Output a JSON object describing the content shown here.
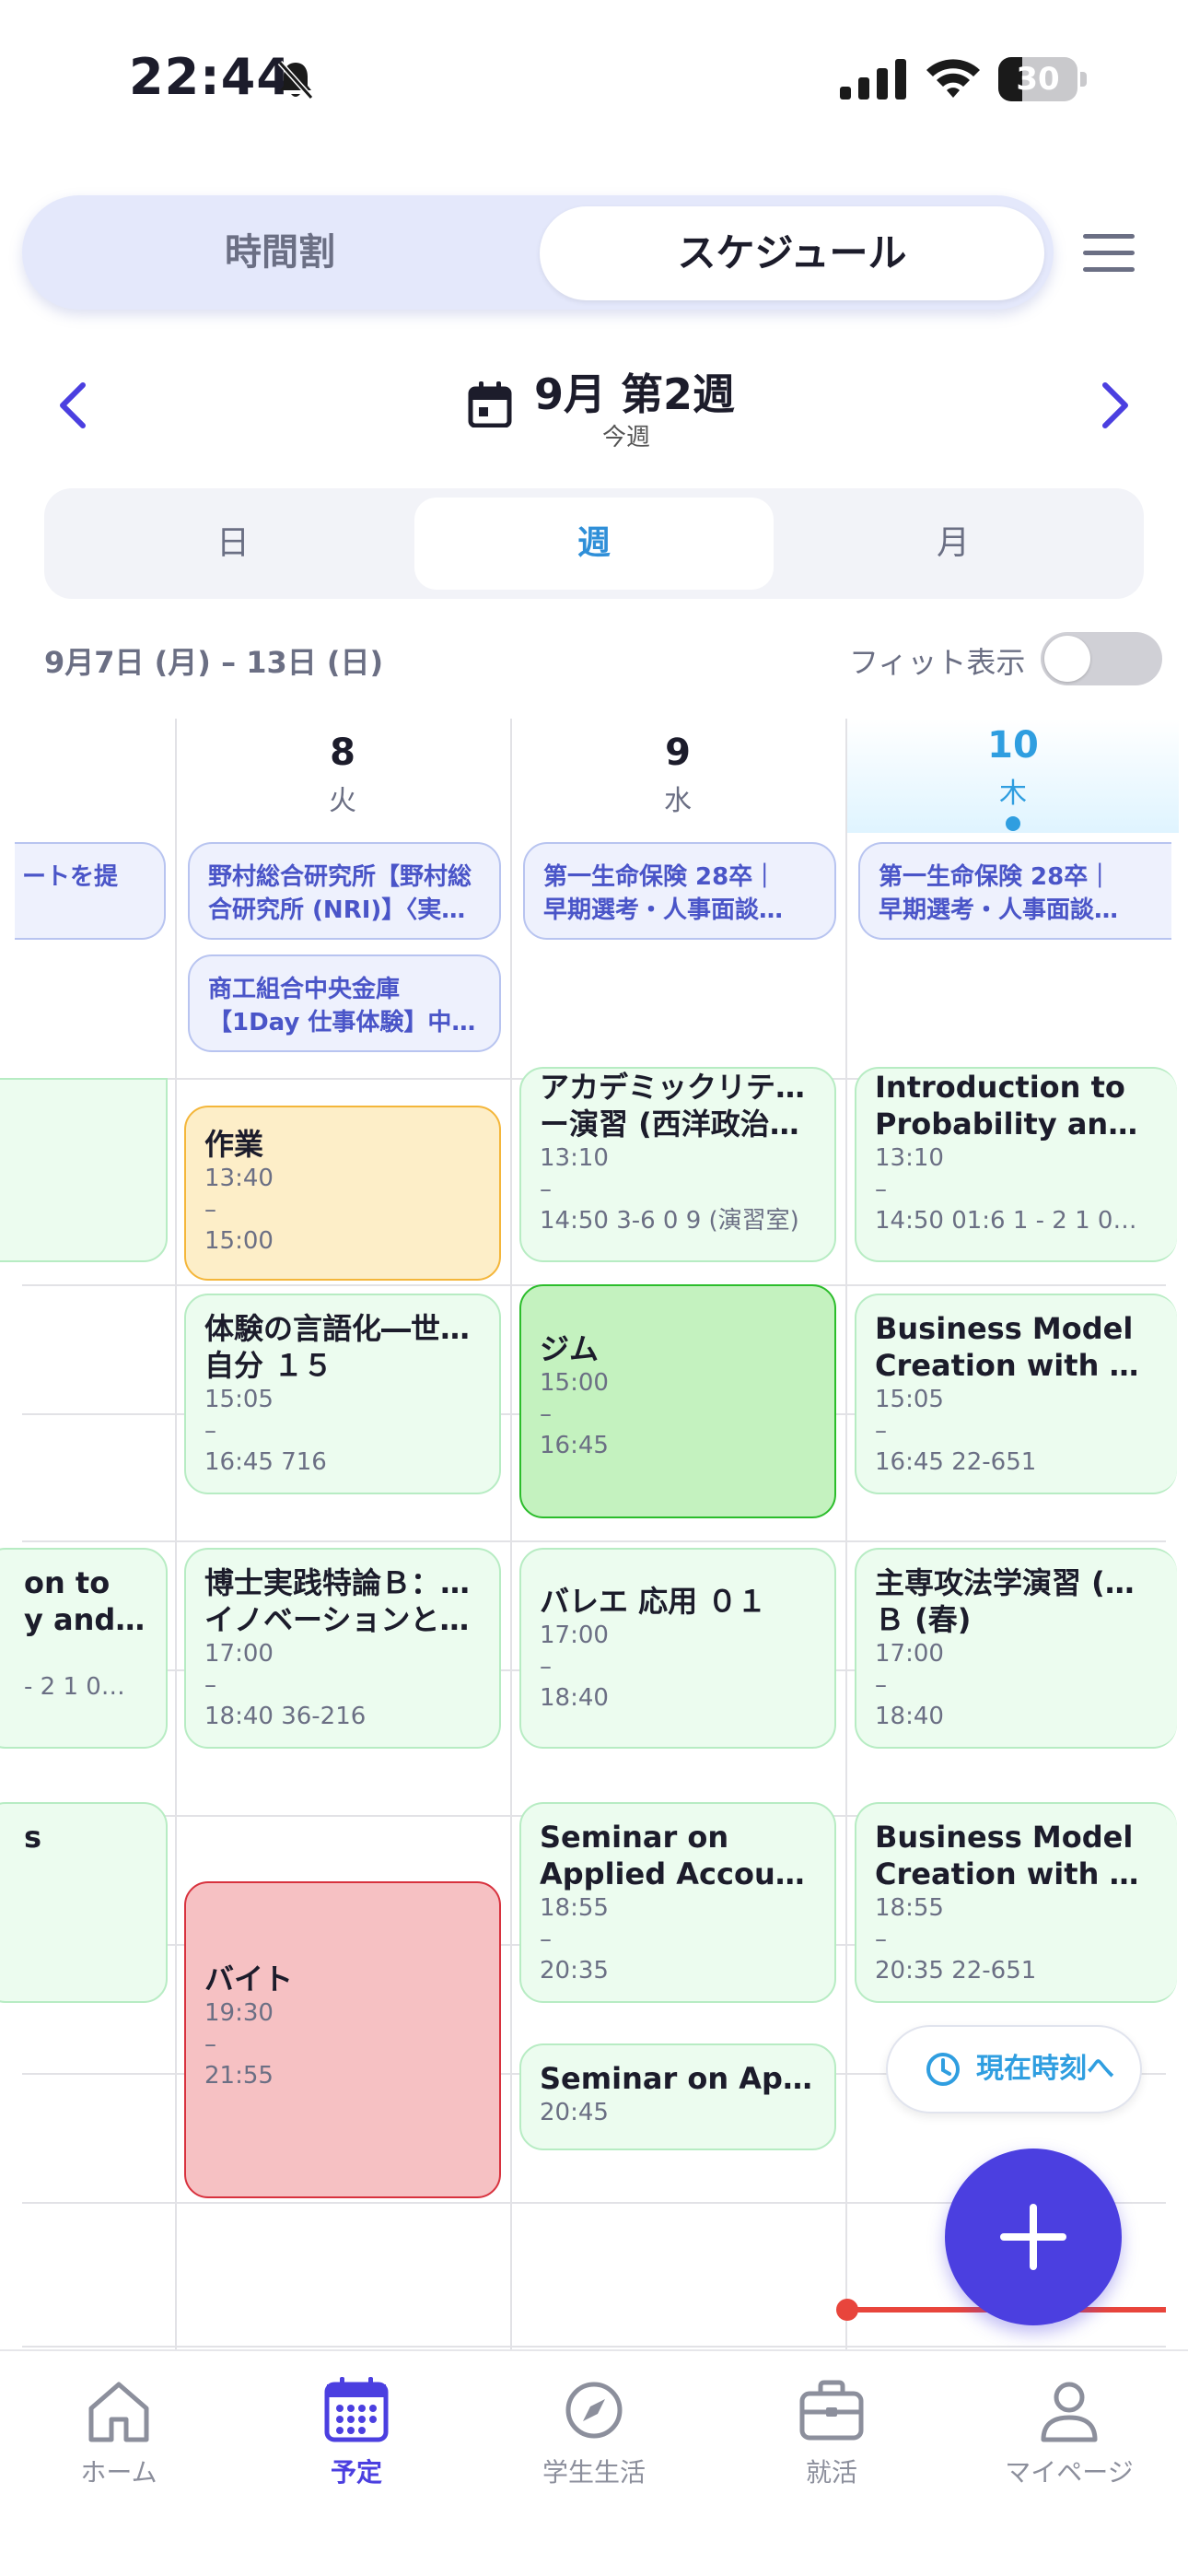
{
  "status": {
    "time": "22:44",
    "battery": "30",
    "battery_level": 0.3
  },
  "toggle_tabs": {
    "left": "時間割",
    "right": "スケジュール"
  },
  "week_nav": {
    "title": "9月 第2週",
    "subtitle": "今週"
  },
  "view_tabs": [
    "日",
    "週",
    "月"
  ],
  "range_label": "9月7日 (月) – 13日 (日)",
  "fit_label": "フィット表示",
  "days": [
    {
      "num": "8",
      "wd": "火"
    },
    {
      "num": "9",
      "wd": "水"
    },
    {
      "num": "10",
      "wd": "木"
    }
  ],
  "allday": {
    "col0": "ートを提",
    "col1a": [
      "野村総合研究所【野村総",
      "合研究所 (NRI)】〈実…"
    ],
    "col1b": [
      "商工組合中央金庫",
      "【1Day 仕事体験】中…"
    ],
    "col2": [
      "第一生命保険 28卒｜",
      "早期選考・人事面談…"
    ],
    "col3": [
      "第一生命保険 28卒｜",
      "早期選考・人事面談…"
    ]
  },
  "events": {
    "mon_a": {
      "title1": "on to",
      "title2": "y and S…",
      "line": "- 2 1 0…"
    },
    "mon_b": {
      "title1": "s"
    },
    "tue_work": {
      "title": "作業",
      "start": "13:40",
      "dash": "–",
      "end": "15:00"
    },
    "tue_lang": {
      "title1": "体験の言語化―世界と",
      "title2": "自分 １５",
      "start": "15:05",
      "dash": "–",
      "end": "16:45  716"
    },
    "tue_phd": {
      "title1": "博士実践特論Ｂ：産業",
      "title2": "イノベーションとキ…",
      "start": "17:00",
      "dash": "–",
      "end": "18:40  36-216"
    },
    "tue_job": {
      "title": "バイト",
      "start": "19:30",
      "dash": "–",
      "end": "21:55"
    },
    "wed_acad": {
      "title1": "アカデミックリテラシ",
      "title2": "ー演習 (西洋政治思…",
      "start": "13:10",
      "dash": "–",
      "end": "14:50  3-6 0 9 (演習室)"
    },
    "wed_gym": {
      "title": "ジム",
      "start": "15:00",
      "dash": "–",
      "end": "16:45"
    },
    "wed_ballet": {
      "title": "バレエ 応用 ０１",
      "start": "17:00",
      "dash": "–",
      "end": "18:40"
    },
    "wed_sem1": {
      "title1": "Seminar on",
      "title2": "Applied Accounti…",
      "start": "18:55",
      "dash": "–",
      "end": "20:35"
    },
    "wed_sem2": {
      "title": "Seminar on Appli…",
      "start": "20:45"
    },
    "thu_prob": {
      "title1": "Introduction to",
      "title2": "Probability and S…",
      "start": "13:10",
      "dash": "–",
      "end": "14:50  01:6 1 - 2 1 0…"
    },
    "thu_biz1": {
      "title1": "Business Model",
      "title2": "Creation with AI…",
      "start": "15:05",
      "dash": "–",
      "end": "16:45  22-651"
    },
    "thu_law": {
      "title1": "主専攻法学演習 (民法)",
      "title2": "Ｂ (春)",
      "start": "17:00",
      "dash": "–",
      "end": "18:40"
    },
    "thu_biz2": {
      "title1": "Business Model",
      "title2": "Creation with AI…",
      "start": "18:55",
      "dash": "–",
      "end": "20:35  22-651"
    }
  },
  "now_button": "現在時刻へ",
  "bottom_nav": [
    "ホーム",
    "予定",
    "学生生活",
    "就活",
    "マイページ"
  ],
  "colors": {
    "accent": "#4b3fe0",
    "today": "#2f9ee0",
    "now_line": "#e8453c"
  }
}
